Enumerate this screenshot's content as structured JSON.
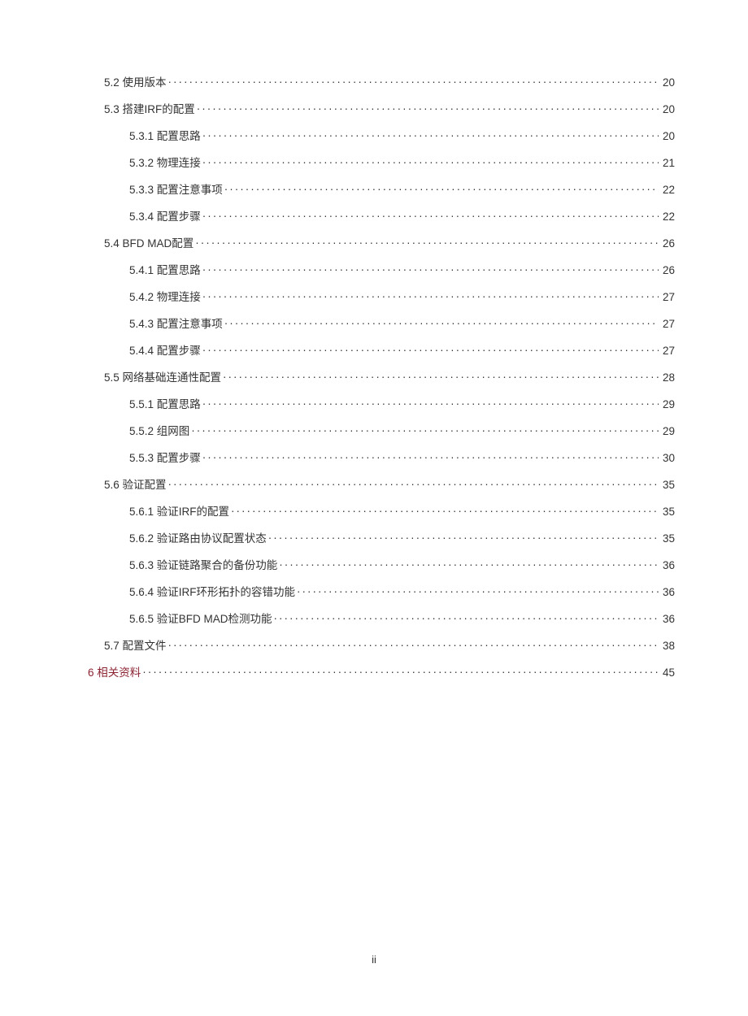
{
  "toc": [
    {
      "level": 2,
      "label": "5.2 使用版本",
      "page": "20"
    },
    {
      "level": 2,
      "label": "5.3 搭建IRF的配置",
      "page": "20"
    },
    {
      "level": 3,
      "label": "5.3.1 配置思路",
      "page": "20"
    },
    {
      "level": 3,
      "label": "5.3.2 物理连接",
      "page": "21"
    },
    {
      "level": 3,
      "label": "5.3.3 配置注意事项",
      "page": "22"
    },
    {
      "level": 3,
      "label": "5.3.4 配置步骤",
      "page": "22"
    },
    {
      "level": 2,
      "label": "5.4 BFD MAD配置",
      "page": "26"
    },
    {
      "level": 3,
      "label": "5.4.1 配置思路",
      "page": "26"
    },
    {
      "level": 3,
      "label": "5.4.2 物理连接",
      "page": "27"
    },
    {
      "level": 3,
      "label": "5.4.3 配置注意事项",
      "page": "27"
    },
    {
      "level": 3,
      "label": "5.4.4 配置步骤",
      "page": "27"
    },
    {
      "level": 2,
      "label": "5.5 网络基础连通性配置",
      "page": "28"
    },
    {
      "level": 3,
      "label": "5.5.1 配置思路",
      "page": "29"
    },
    {
      "level": 3,
      "label": "5.5.2 组网图",
      "page": "29"
    },
    {
      "level": 3,
      "label": "5.5.3 配置步骤",
      "page": "30"
    },
    {
      "level": 2,
      "label": "5.6 验证配置",
      "page": "35"
    },
    {
      "level": 3,
      "label": "5.6.1 验证IRF的配置",
      "page": "35"
    },
    {
      "level": 3,
      "label": "5.6.2 验证路由协议配置状态",
      "page": "35"
    },
    {
      "level": 3,
      "label": "5.6.3 验证链路聚合的备份功能",
      "page": "36"
    },
    {
      "level": 3,
      "label": "5.6.4 验证IRF环形拓扑的容错功能",
      "page": "36"
    },
    {
      "level": 3,
      "label": "5.6.5 验证BFD MAD检测功能",
      "page": "36"
    },
    {
      "level": 2,
      "label": "5.7 配置文件",
      "page": "38"
    },
    {
      "level": 1,
      "label": "6 相关资料",
      "page": "45",
      "class": "section-6"
    }
  ],
  "pageNumber": "ii"
}
